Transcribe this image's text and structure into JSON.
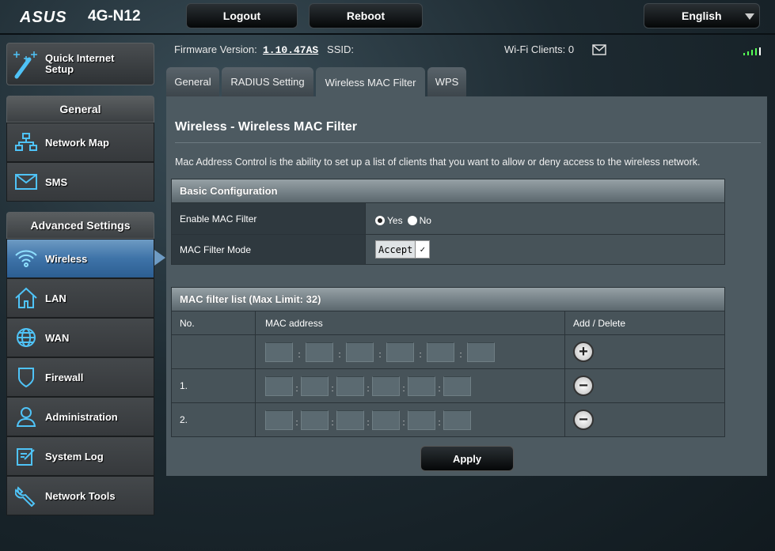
{
  "header": {
    "brand": "ASUS",
    "model": "4G-N12",
    "logout": "Logout",
    "reboot": "Reboot",
    "language": "English"
  },
  "info": {
    "firmware_label": "Firmware Version:",
    "firmware_value": "1.10.47AS",
    "ssid_label": "SSID:",
    "wifi_clients": "Wi-Fi Clients: 0"
  },
  "sidebar": {
    "quick_setup": "Quick Internet Setup",
    "general_header": "General",
    "general_items": [
      {
        "label": "Network Map",
        "icon": "network-map-icon"
      },
      {
        "label": "SMS",
        "icon": "envelope-icon"
      }
    ],
    "advanced_header": "Advanced Settings",
    "advanced_items": [
      {
        "label": "Wireless",
        "icon": "wifi-icon",
        "active": true
      },
      {
        "label": "LAN",
        "icon": "home-icon"
      },
      {
        "label": "WAN",
        "icon": "globe-icon"
      },
      {
        "label": "Firewall",
        "icon": "shield-icon"
      },
      {
        "label": "Administration",
        "icon": "user-icon"
      },
      {
        "label": "System Log",
        "icon": "log-icon"
      },
      {
        "label": "Network Tools",
        "icon": "wrench-icon"
      }
    ]
  },
  "tabs": [
    {
      "label": "General"
    },
    {
      "label": "RADIUS Setting"
    },
    {
      "label": "Wireless MAC Filter",
      "active": true
    },
    {
      "label": "WPS"
    }
  ],
  "main": {
    "title": "Wireless - Wireless MAC Filter",
    "description": "Mac Address Control is the ability to set up a list of clients that you want to allow or deny access to the wireless network.",
    "basic": {
      "header": "Basic Configuration",
      "enable_label": "Enable MAC Filter",
      "yes": "Yes",
      "no": "No",
      "enabled": "Yes",
      "mode_label": "MAC Filter Mode",
      "mode_value": "Accept"
    },
    "list": {
      "header": "MAC filter list (Max Limit: 32)",
      "col_no": "No.",
      "col_mac": "MAC address",
      "col_action": "Add / Delete",
      "rows": [
        {
          "no": ""
        },
        {
          "no": "1."
        },
        {
          "no": "2."
        }
      ]
    },
    "apply": "Apply"
  },
  "colors": {
    "accent": "#4fc3f7",
    "active_nav": "#3e73a8",
    "panel": "#4d5a61"
  }
}
